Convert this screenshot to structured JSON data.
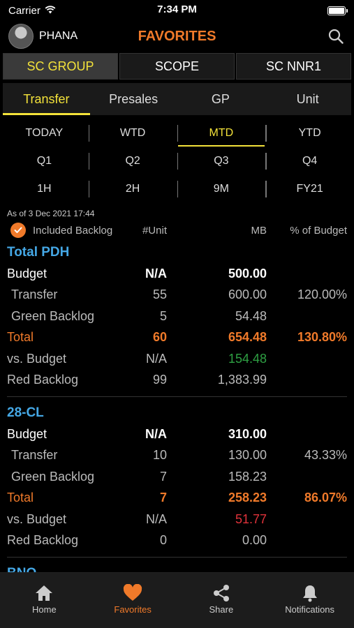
{
  "status_bar": {
    "carrier": "Carrier",
    "time": "7:34 PM"
  },
  "header": {
    "username": "PHANA",
    "title": "FAVORITES"
  },
  "group_tabs": [
    "SC GROUP",
    "SCOPE",
    "SC NNR1"
  ],
  "type_tabs": [
    "Transfer",
    "Presales",
    "GP",
    "Unit"
  ],
  "periods": [
    [
      "TODAY",
      "WTD",
      "MTD",
      "YTD"
    ],
    [
      "Q1",
      "Q2",
      "Q3",
      "Q4"
    ],
    [
      "1H",
      "2H",
      "9M",
      "FY21"
    ]
  ],
  "as_of": "As of 3 Dec 2021 17:44",
  "columns": {
    "included_backlog": "Included Backlog",
    "unit": "#Unit",
    "mb": "MB",
    "pct": "% of Budget"
  },
  "sections": [
    {
      "title": "Total PDH",
      "budget": {
        "label": "Budget",
        "unit": "N/A",
        "mb": "500.00",
        "pct": ""
      },
      "transfer": {
        "label": "Transfer",
        "unit": "55",
        "mb": "600.00",
        "pct": "120.00%"
      },
      "green_backlog": {
        "label": "Green Backlog",
        "unit": "5",
        "mb": "54.48",
        "pct": ""
      },
      "total": {
        "label": "Total",
        "unit": "60",
        "mb": "654.48",
        "pct": "130.80%"
      },
      "vs_budget": {
        "label": "vs. Budget",
        "unit": "N/A",
        "mb": "154.48",
        "pct": ""
      },
      "red_backlog": {
        "label": "Red Backlog",
        "unit": "99",
        "mb": "1,383.99",
        "pct": ""
      }
    },
    {
      "title": "28-CL",
      "budget": {
        "label": "Budget",
        "unit": "N/A",
        "mb": "310.00",
        "pct": ""
      },
      "transfer": {
        "label": "Transfer",
        "unit": "10",
        "mb": "130.00",
        "pct": "43.33%"
      },
      "green_backlog": {
        "label": "Green Backlog",
        "unit": "7",
        "mb": "158.23",
        "pct": ""
      },
      "total": {
        "label": "Total",
        "unit": "7",
        "mb": "258.23",
        "pct": "86.07%"
      },
      "vs_budget": {
        "label": "vs. Budget",
        "unit": "N/A",
        "mb": "51.77",
        "pct": ""
      },
      "red_backlog": {
        "label": "Red Backlog",
        "unit": "0",
        "mb": "0.00",
        "pct": ""
      }
    }
  ],
  "partial_section_title": "BNO",
  "tabbar": [
    {
      "label": "Home",
      "icon": "home-icon"
    },
    {
      "label": "Favorites",
      "icon": "heart-icon"
    },
    {
      "label": "Share",
      "icon": "share-icon"
    },
    {
      "label": "Notifications",
      "icon": "bell-icon"
    }
  ],
  "colors": {
    "accent_orange": "#f07a2a",
    "accent_yellow": "#f3e23a",
    "link_blue": "#45a8e6",
    "positive_green": "#2ea043",
    "negative_red": "#e0323a"
  }
}
